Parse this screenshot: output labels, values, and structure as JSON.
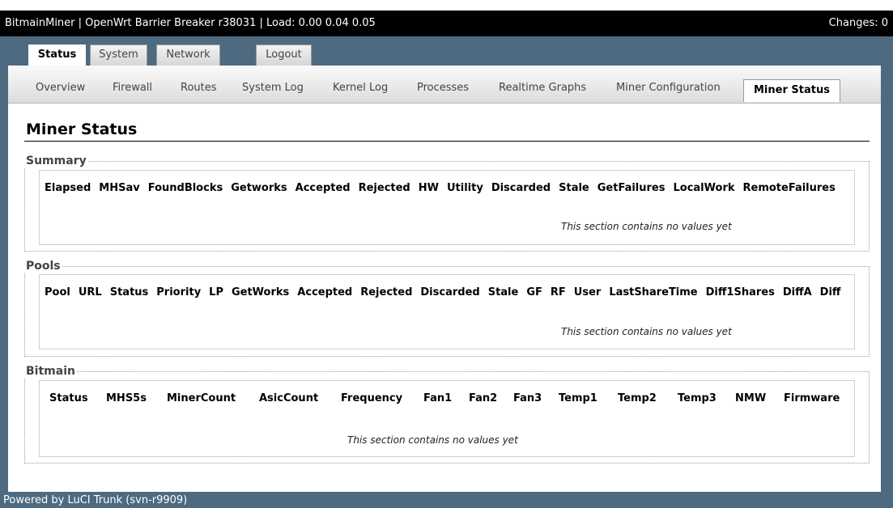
{
  "header": {
    "title": "BitmainMiner | OpenWrt Barrier Breaker r38031 | Load: 0.00 0.04 0.05",
    "changes": "Changes: 0"
  },
  "main_tabs": [
    {
      "label": "Status",
      "active": true
    },
    {
      "label": "System",
      "active": false
    },
    {
      "label": "Network",
      "active": false
    },
    {
      "label": "Logout",
      "active": false
    }
  ],
  "sub_tabs": [
    {
      "label": "Overview"
    },
    {
      "label": "Firewall"
    },
    {
      "label": "Routes"
    },
    {
      "label": "System Log"
    },
    {
      "label": "Kernel Log"
    },
    {
      "label": "Processes"
    },
    {
      "label": "Realtime Graphs"
    },
    {
      "label": "Miner Configuration"
    },
    {
      "label": "Miner Status",
      "active": true
    }
  ],
  "page_title": "Miner Status",
  "sections": {
    "summary": {
      "legend": "Summary",
      "columns": [
        "Elapsed",
        "MHSav",
        "FoundBlocks",
        "Getworks",
        "Accepted",
        "Rejected",
        "HW",
        "Utility",
        "Discarded",
        "Stale",
        "GetFailures",
        "LocalWork",
        "RemoteFailures"
      ],
      "empty_text": "This section contains no values yet"
    },
    "pools": {
      "legend": "Pools",
      "columns": [
        "Pool",
        "URL",
        "Status",
        "Priority",
        "LP",
        "GetWorks",
        "Accepted",
        "Rejected",
        "Discarded",
        "Stale",
        "GF",
        "RF",
        "User",
        "LastShareTime",
        "Diff1Shares",
        "DiffA",
        "Diff"
      ],
      "empty_text": "This section contains no values yet"
    },
    "bitmain": {
      "legend": "Bitmain",
      "columns": [
        "Status",
        "MHS5s",
        "MinerCount",
        "AsicCount",
        "Frequency",
        "Fan1",
        "Fan2",
        "Fan3",
        "Temp1",
        "Temp2",
        "Temp3",
        "NMW",
        "Firmware"
      ],
      "empty_text": "This section contains no values yet"
    }
  },
  "footer": "Powered by LuCI Trunk (svn-r9909)"
}
